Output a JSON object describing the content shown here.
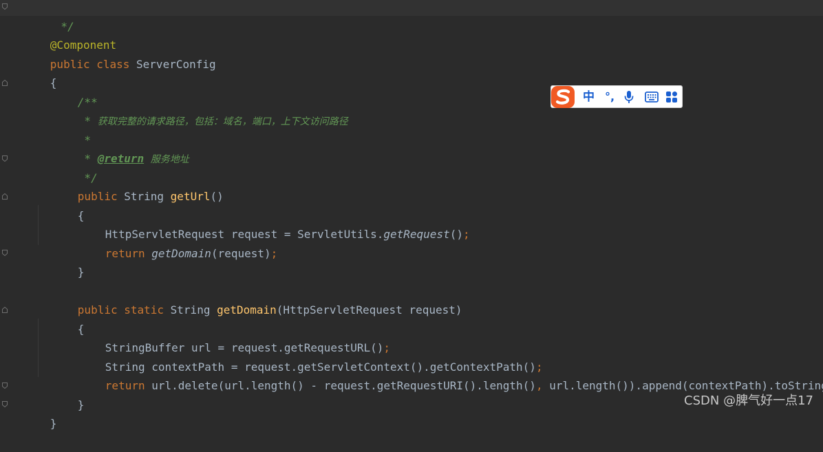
{
  "editor": {
    "lines": {
      "l1": {
        "t1": " */"
      },
      "l2": {
        "t1": "@Component"
      },
      "l3": {
        "t1": "public class ",
        "t2": "ServerConfig"
      },
      "l4": {
        "t1": "{"
      },
      "l5": {
        "t1": "/**"
      },
      "l6": {
        "t1": " * ",
        "t2": "获取完整的请求路径，包括：域名，端口，上下文访问路径"
      },
      "l7": {
        "t1": " *"
      },
      "l8": {
        "t1": " * ",
        "t2": "@return",
        "t3": " ",
        "t4": "服务地址"
      },
      "l9": {
        "t1": " */"
      },
      "l10": {
        "t1": "public ",
        "t2": "String ",
        "t3": "getUrl",
        "t4": "()"
      },
      "l11": {
        "t1": "{"
      },
      "l12": {
        "t1": "HttpServletRequest request = ServletUtils.",
        "t2": "getRequest",
        "t3": "()",
        "t4": ";"
      },
      "l13": {
        "t1": "return ",
        "t2": "getDomain",
        "t3": "(request)",
        "t4": ";"
      },
      "l14": {
        "t1": "}"
      },
      "l15": {
        "t1": "public static ",
        "t2": "String ",
        "t3": "getDomain",
        "t4": "(HttpServletRequest request)"
      },
      "l16": {
        "t1": "{"
      },
      "l17": {
        "t1": "StringBuffer url = request.getRequestURL()",
        "t2": ";"
      },
      "l18": {
        "t1": "String contextPath = request.getServletContext().getContextPath()",
        "t2": ";"
      },
      "l19": {
        "t1": "return ",
        "t2": "url.delete(url.length() - request.getRequestURI().length()",
        "t3": ", ",
        "t4": "url.length()).append(contextPath).toString("
      },
      "l20": {
        "t1": "}"
      },
      "l21": {
        "t1": "}"
      }
    }
  },
  "ime_toolbar": {
    "logo": "sogou-logo",
    "mode_label": "中",
    "punct_label": "°,",
    "icons": [
      "microphone-icon",
      "keyboard-icon",
      "apps-grid-icon"
    ]
  },
  "watermark": {
    "text": "CSDN @脾气好一点17"
  },
  "colors": {
    "background": "#2b2b2b",
    "keyword": "#cc7832",
    "annotation": "#bbb529",
    "method": "#ffc66d",
    "doc_comment": "#629755",
    "text": "#a9b7c6",
    "ime_blue": "#1a5fd0",
    "logo_orange": "#f15a24"
  }
}
